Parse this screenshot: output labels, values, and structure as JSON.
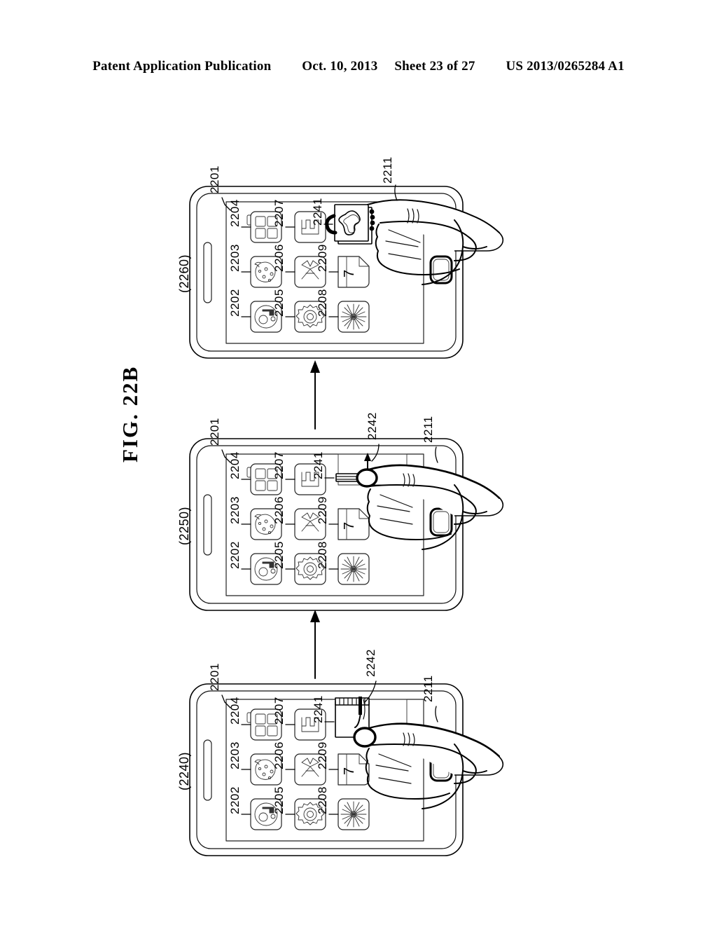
{
  "header": {
    "publication": "Patent Application Publication",
    "date": "Oct. 10, 2013",
    "sheet": "Sheet 23 of 27",
    "patent_number": "US 2013/0265284 A1"
  },
  "figure": {
    "title": "FIG.  22B"
  },
  "panels": [
    {
      "id": "bottom",
      "state_label": "(2240)",
      "device_ref": "2201",
      "hand_ref": "2211",
      "gesture_ref": "2242",
      "icon_state": "partially-rolled",
      "icons": [
        {
          "ref": "2204",
          "name": "grid-icon",
          "row": 0,
          "col": 0
        },
        {
          "ref": "2207",
          "name": "mail-icon",
          "row": 0,
          "col": 1
        },
        {
          "ref": "2241",
          "name": "peeling-icon",
          "row": 0,
          "col": 2
        },
        {
          "ref": "2203",
          "name": "map-icon",
          "row": 1,
          "col": 0
        },
        {
          "ref": "2206",
          "name": "scissors-icon",
          "row": 1,
          "col": 1
        },
        {
          "ref": "2209",
          "name": "calendar-icon",
          "row": 1,
          "col": 2,
          "day": "7"
        },
        {
          "ref": "2202",
          "name": "camera-icon",
          "row": 2,
          "col": 0
        },
        {
          "ref": "2205",
          "name": "settings-icon",
          "row": 2,
          "col": 1
        },
        {
          "ref": "2208",
          "name": "starburst-icon",
          "row": 2,
          "col": 2
        }
      ]
    },
    {
      "id": "middle",
      "state_label": "(2250)",
      "device_ref": "2201",
      "hand_ref": "2211",
      "gesture_ref": "2242",
      "icon_state": "fully-rolled",
      "icons": [
        {
          "ref": "2204",
          "name": "grid-icon",
          "row": 0,
          "col": 0
        },
        {
          "ref": "2207",
          "name": "mail-icon",
          "row": 0,
          "col": 1
        },
        {
          "ref": "2241",
          "name": "rolled-icon",
          "row": 0,
          "col": 2
        },
        {
          "ref": "2203",
          "name": "map-icon",
          "row": 1,
          "col": 0
        },
        {
          "ref": "2206",
          "name": "scissors-icon",
          "row": 1,
          "col": 1
        },
        {
          "ref": "2209",
          "name": "calendar-icon",
          "row": 1,
          "col": 2,
          "day": "7"
        },
        {
          "ref": "2202",
          "name": "camera-icon",
          "row": 2,
          "col": 0
        },
        {
          "ref": "2205",
          "name": "settings-icon",
          "row": 2,
          "col": 1
        },
        {
          "ref": "2208",
          "name": "starburst-icon",
          "row": 2,
          "col": 2
        }
      ]
    },
    {
      "id": "top",
      "state_label": "(2260)",
      "device_ref": "2201",
      "hand_ref": "2211",
      "gesture_ref": "",
      "icon_state": "crumpled",
      "icons": [
        {
          "ref": "2204",
          "name": "grid-icon",
          "row": 0,
          "col": 0
        },
        {
          "ref": "2207",
          "name": "mail-icon",
          "row": 0,
          "col": 1
        },
        {
          "ref": "2241",
          "name": "crumpled-icon",
          "row": 0,
          "col": 2
        },
        {
          "ref": "2203",
          "name": "map-icon",
          "row": 1,
          "col": 0
        },
        {
          "ref": "2206",
          "name": "scissors-icon",
          "row": 1,
          "col": 1
        },
        {
          "ref": "2209",
          "name": "calendar-icon",
          "row": 1,
          "col": 2,
          "day": "7"
        },
        {
          "ref": "2202",
          "name": "camera-icon",
          "row": 2,
          "col": 0
        },
        {
          "ref": "2205",
          "name": "settings-icon",
          "row": 2,
          "col": 1
        },
        {
          "ref": "2208",
          "name": "starburst-icon",
          "row": 2,
          "col": 2
        }
      ]
    }
  ],
  "colors": {
    "ink": "#000000",
    "paper": "#ffffff"
  }
}
